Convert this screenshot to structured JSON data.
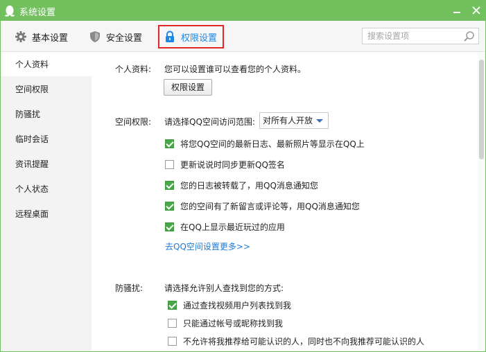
{
  "window": {
    "title": "系统设置"
  },
  "tabs": [
    {
      "label": "基本设置",
      "icon": "gear-icon"
    },
    {
      "label": "安全设置",
      "icon": "shield-icon"
    },
    {
      "label": "权限设置",
      "icon": "lock-icon",
      "selected": true
    }
  ],
  "search": {
    "placeholder": "搜索设置项",
    "value": ""
  },
  "sidebar": {
    "items": [
      {
        "label": "个人资料",
        "active": true
      },
      {
        "label": "空间权限"
      },
      {
        "label": "防骚扰"
      },
      {
        "label": "临时会话"
      },
      {
        "label": "资讯提醒"
      },
      {
        "label": "个人状态"
      },
      {
        "label": "远程桌面"
      }
    ]
  },
  "profile": {
    "label": "个人资料:",
    "description": "您可以设置谁可以查看您的个人资料。",
    "button": "权限设置"
  },
  "space": {
    "label": "空间权限:",
    "prompt": "请选择QQ空间访问范围:",
    "range_value": "对所有人开放",
    "options": [
      {
        "label": "将您QQ空间的最新日志、最新照片等显示在QQ上",
        "checked": true
      },
      {
        "label": "更新说说时同步更新QQ签名",
        "checked": false
      },
      {
        "label": "您的日志被转载了，用QQ消息通知您",
        "checked": true
      },
      {
        "label": "您的空间有了新留言或评论等，用QQ消息通知您",
        "checked": true
      },
      {
        "label": "在QQ上显示最近玩过的应用",
        "checked": true
      }
    ],
    "more_link": "去QQ空间设置更多>>"
  },
  "harassment": {
    "label": "防骚扰:",
    "prompt": "请选择允许别人查找到您的方式:",
    "options": [
      {
        "label": "通过查找视频用户列表找到我",
        "checked": true
      },
      {
        "label": "只能通过帐号或昵称找到我",
        "checked": false
      },
      {
        "label": "不允许将我推荐给可能认识的人，同时也不向我推荐可能认识的人",
        "checked": false
      }
    ]
  },
  "colors": {
    "titlebar": "#73c05f",
    "accent_blue": "#1e88e5",
    "highlight_red": "#e32626",
    "checkbox_green": "#4aa64a"
  }
}
